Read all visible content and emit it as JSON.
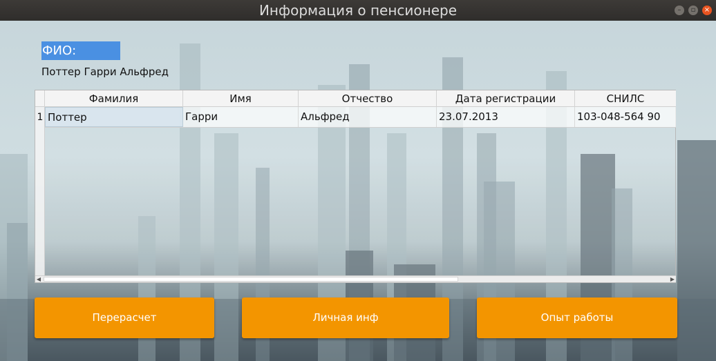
{
  "window": {
    "title": "Информация о пенсионере"
  },
  "fio": {
    "label": "ФИО:",
    "value": "Поттер Гарри Альфред"
  },
  "table": {
    "columns": [
      "Фамилия",
      "Имя",
      "Отчество",
      "Дата регистрации",
      "СНИЛС"
    ],
    "rows": [
      {
        "num": "1",
        "cells": [
          "Поттер",
          "Гарри",
          "Альфред",
          "23.07.2013",
          "103-048-564 90"
        ]
      }
    ]
  },
  "buttons": {
    "recalc": "Перерасчет",
    "personal": "Личная инф",
    "experience": "Опыт работы"
  },
  "icons": {
    "minimize": "minimize-icon",
    "maximize": "maximize-icon",
    "close": "close-icon"
  },
  "colors": {
    "accent": "#f39500",
    "selection": "#4a90e2",
    "close": "#e95420"
  }
}
